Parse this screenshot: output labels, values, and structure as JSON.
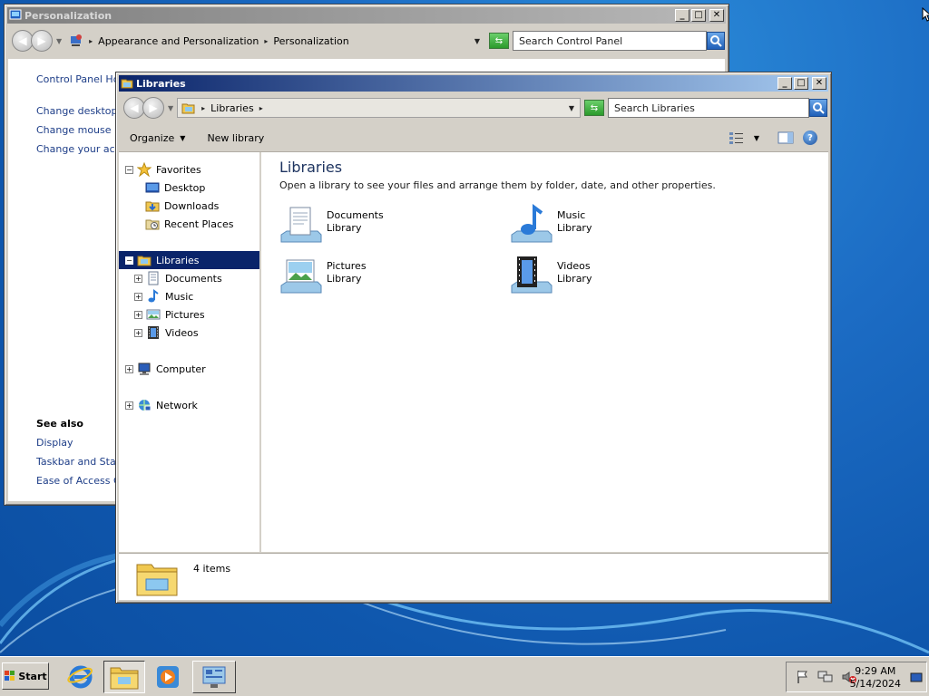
{
  "personalization": {
    "title": "Personalization",
    "breadcrumb": [
      "Appearance and Personalization",
      "Personalization"
    ],
    "search_placeholder": "Search Control Panel",
    "sidebar_links": {
      "home": "Control Panel Home",
      "desktop_icons": "Change desktop ico",
      "mouse_pointers": "Change mouse poin",
      "account_picture": "Change your accou"
    },
    "see_also": {
      "heading": "See also",
      "display": "Display",
      "taskbar": "Taskbar and Start I",
      "ease_of_access": "Ease of Access Cer"
    }
  },
  "libraries": {
    "title": "Libraries",
    "address": "Libraries",
    "search_placeholder": "Search Libraries",
    "commands": {
      "organize": "Organize",
      "new_library": "New library"
    },
    "tree": {
      "favorites": "Favorites",
      "desktop": "Desktop",
      "downloads": "Downloads",
      "recent_places": "Recent Places",
      "libraries": "Libraries",
      "documents": "Documents",
      "music": "Music",
      "pictures": "Pictures",
      "videos": "Videos",
      "computer": "Computer",
      "network": "Network"
    },
    "heading": "Libraries",
    "subheading": "Open a library to see your files and arrange them by folder, date, and other properties.",
    "items": [
      {
        "name": "Documents",
        "kind": "Library"
      },
      {
        "name": "Music",
        "kind": "Library"
      },
      {
        "name": "Pictures",
        "kind": "Library"
      },
      {
        "name": "Videos",
        "kind": "Library"
      }
    ],
    "status": "4 items"
  },
  "taskbar": {
    "start_label": "Start",
    "time": "9:29 AM",
    "date": "5/14/2024"
  },
  "colors": {
    "desktop_blue": "#1c6cc4",
    "active_title": "#0a246a",
    "link_blue": "#1e3e88"
  }
}
